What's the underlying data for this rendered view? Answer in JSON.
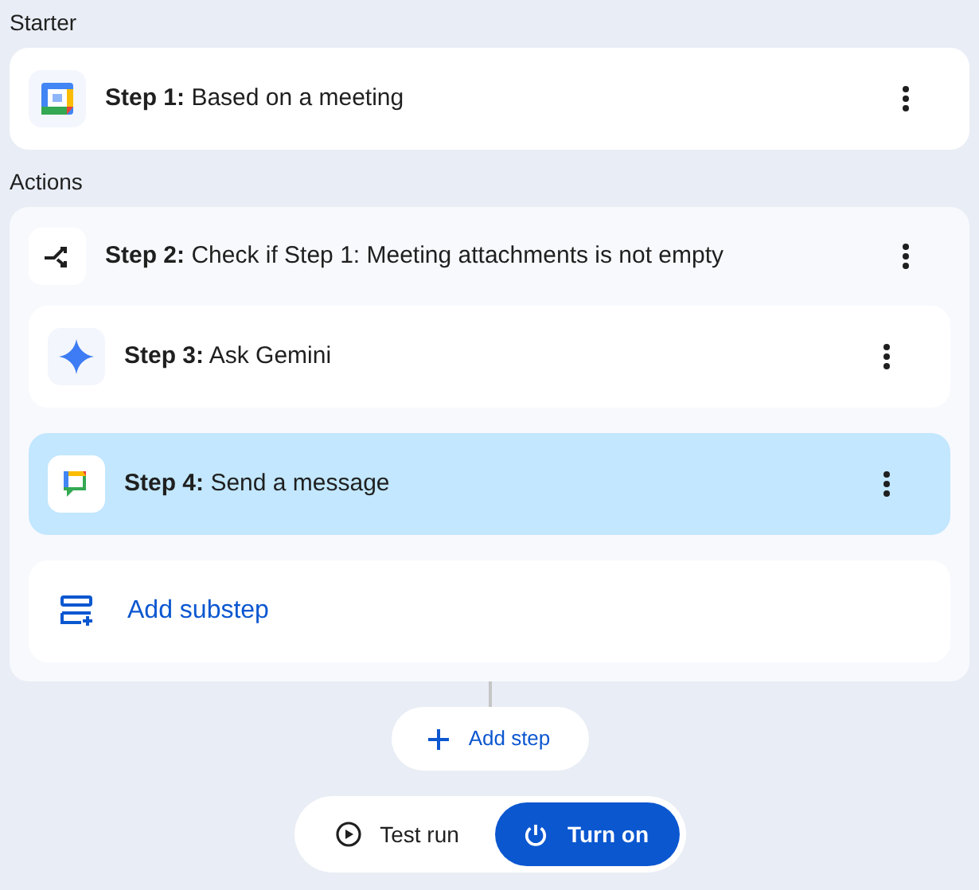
{
  "starter": {
    "heading": "Starter",
    "step": {
      "number": "Step 1:",
      "text": "Based on a meeting",
      "kind": "calendar",
      "selected": false
    }
  },
  "actions": {
    "heading": "Actions",
    "step": {
      "number": "Step 2:",
      "text": "Check if Step 1: Meeting attachments is not empty",
      "kind": "condition",
      "selected": false
    },
    "substeps": [
      {
        "number": "Step 3:",
        "text": "Ask Gemini",
        "kind": "gemini",
        "selected": false
      },
      {
        "number": "Step 4:",
        "text": "Send a message",
        "kind": "chat",
        "selected": true
      }
    ],
    "add_substep": "Add substep"
  },
  "add_step": "Add step",
  "footer": {
    "test_run": "Test run",
    "turn_on": "Turn on"
  }
}
